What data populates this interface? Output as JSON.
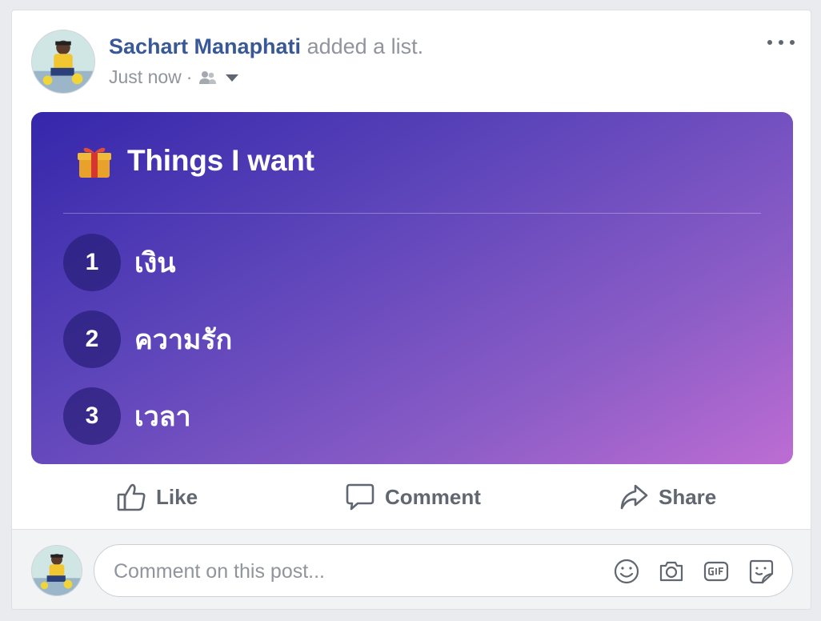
{
  "post": {
    "author": "Sachart Manaphati",
    "action": "added a list.",
    "timestamp": "Just now",
    "separator": "·",
    "audience_icon": "friends-icon",
    "more_icon": "more-options-icon"
  },
  "list": {
    "title": "Things I want",
    "emoji_icon": "gift-icon",
    "gradient": [
      "#3527ab",
      "#bd6dd3"
    ],
    "items": [
      {
        "number": "1",
        "text": "เงิน"
      },
      {
        "number": "2",
        "text": "ความรัก"
      },
      {
        "number": "3",
        "text": "เวลา"
      }
    ]
  },
  "actions": {
    "like": "Like",
    "comment": "Comment",
    "share": "Share"
  },
  "composer": {
    "placeholder": "Comment on this post...",
    "icons": [
      "emoji-icon",
      "camera-icon",
      "gif-icon",
      "sticker-icon"
    ]
  },
  "colors": {
    "author_link": "#385898",
    "secondary_text": "#90949c",
    "action_text": "#606770"
  }
}
